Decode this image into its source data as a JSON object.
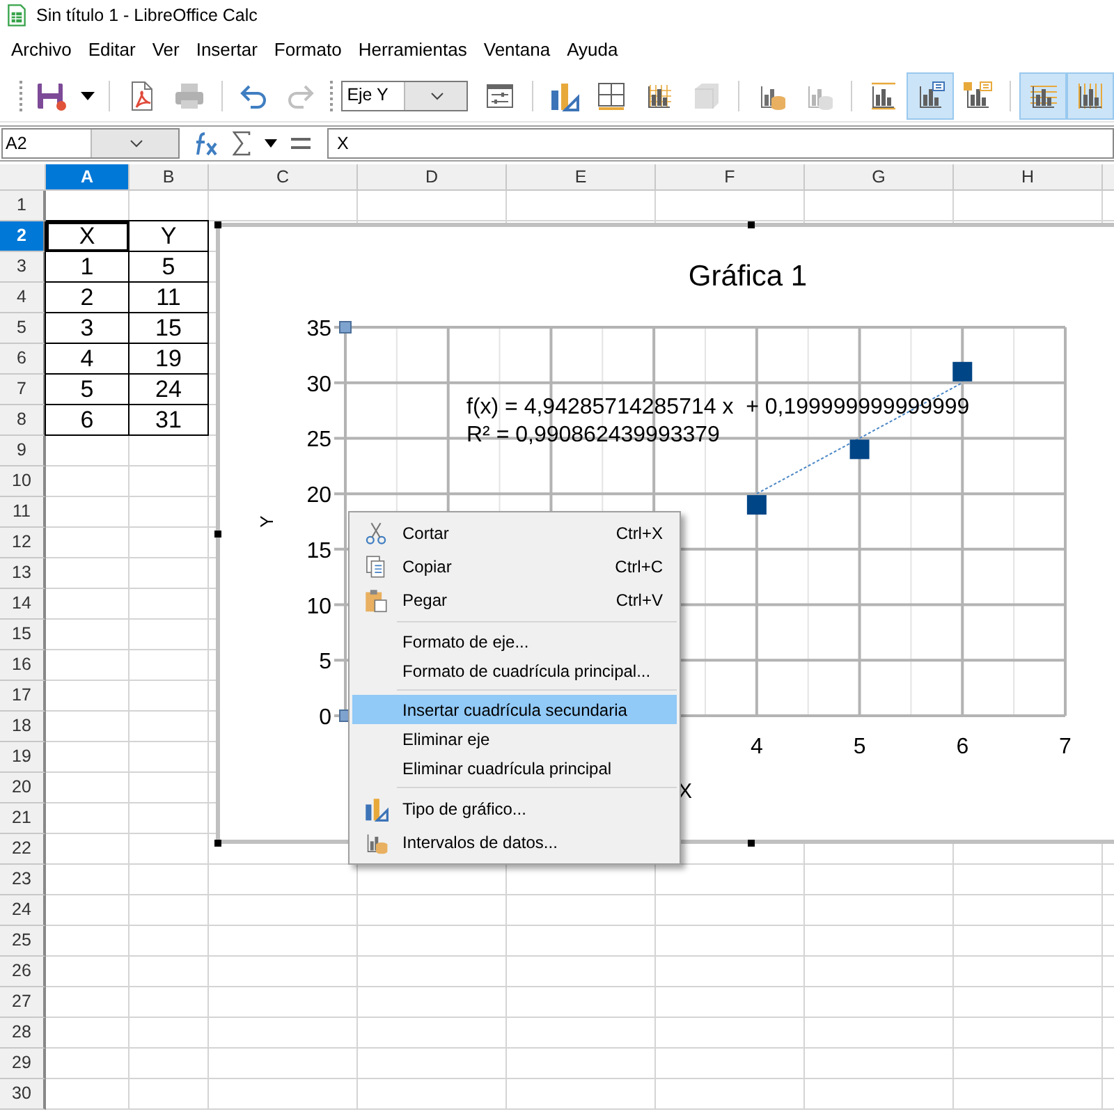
{
  "window": {
    "title": "Sin título 1 - LibreOffice Calc"
  },
  "menu_bar": [
    "Archivo",
    "Editar",
    "Ver",
    "Insertar",
    "Formato",
    "Herramientas",
    "Ventana",
    "Ayuda"
  ],
  "toolbar": {
    "groups": [
      [
        {
          "kind": "save",
          "disabled": false,
          "on": false
        },
        {
          "kind": "dropdown",
          "disabled": false,
          "on": false
        }
      ],
      [
        {
          "kind": "export-pdf",
          "disabled": false,
          "on": false
        },
        {
          "kind": "print",
          "disabled": true,
          "on": false
        }
      ],
      [
        {
          "kind": "undo",
          "disabled": false,
          "on": false
        },
        {
          "kind": "redo",
          "disabled": true,
          "on": false
        }
      ]
    ],
    "object_select": "Eje Y",
    "chart_groups": [
      [
        {
          "kind": "format-selection",
          "disabled": false,
          "on": false
        }
      ],
      [
        {
          "kind": "chart-type",
          "disabled": false,
          "on": false
        },
        {
          "kind": "grid",
          "disabled": false,
          "on": false
        },
        {
          "kind": "chart-wall",
          "disabled": false,
          "on": false
        },
        {
          "kind": "view3d",
          "disabled": true,
          "on": false
        }
      ],
      [
        {
          "kind": "data-ranges",
          "disabled": false,
          "on": false
        },
        {
          "kind": "data-table",
          "disabled": true,
          "on": false
        }
      ],
      [
        {
          "kind": "titles",
          "disabled": false,
          "on": false
        },
        {
          "kind": "legend-toggle",
          "disabled": false,
          "on": true
        },
        {
          "kind": "legend",
          "disabled": false,
          "on": false
        }
      ],
      [
        {
          "kind": "horizontal-grids",
          "disabled": false,
          "on": true
        },
        {
          "kind": "vertical-grids",
          "disabled": false,
          "on": true
        }
      ]
    ]
  },
  "formula_bar": {
    "name_box": "A2",
    "formula": "X"
  },
  "sheet": {
    "columns": [
      {
        "label": "A",
        "selected": true
      },
      {
        "label": "B",
        "selected": false
      },
      {
        "label": "C",
        "selected": false
      },
      {
        "label": "D",
        "selected": false
      },
      {
        "label": "E",
        "selected": false
      },
      {
        "label": "F",
        "selected": false
      },
      {
        "label": "G",
        "selected": false
      },
      {
        "label": "H",
        "selected": false
      }
    ],
    "rows": [
      {
        "label": "1",
        "selected": false
      },
      {
        "label": "2",
        "selected": true
      },
      {
        "label": "3",
        "selected": false
      },
      {
        "label": "4",
        "selected": false
      },
      {
        "label": "5",
        "selected": false
      },
      {
        "label": "6",
        "selected": false
      },
      {
        "label": "7",
        "selected": false
      },
      {
        "label": "8",
        "selected": false
      },
      {
        "label": "9",
        "selected": false
      },
      {
        "label": "10",
        "selected": false
      },
      {
        "label": "11",
        "selected": false
      },
      {
        "label": "12",
        "selected": false
      },
      {
        "label": "13",
        "selected": false
      },
      {
        "label": "14",
        "selected": false
      },
      {
        "label": "15",
        "selected": false
      },
      {
        "label": "16",
        "selected": false
      },
      {
        "label": "17",
        "selected": false
      },
      {
        "label": "18",
        "selected": false
      },
      {
        "label": "19",
        "selected": false
      },
      {
        "label": "20",
        "selected": false
      },
      {
        "label": "21",
        "selected": false
      },
      {
        "label": "22",
        "selected": false
      },
      {
        "label": "23",
        "selected": false
      },
      {
        "label": "24",
        "selected": false
      },
      {
        "label": "25",
        "selected": false
      },
      {
        "label": "26",
        "selected": false
      },
      {
        "label": "27",
        "selected": false
      },
      {
        "label": "28",
        "selected": false
      },
      {
        "label": "29",
        "selected": false
      },
      {
        "label": "30",
        "selected": false
      }
    ],
    "data": [
      [
        {
          "text": "X",
          "cursor": true
        },
        {
          "text": "Y",
          "cursor": false
        }
      ],
      [
        {
          "text": "1",
          "cursor": false
        },
        {
          "text": "5",
          "cursor": false
        }
      ],
      [
        {
          "text": "2",
          "cursor": false
        },
        {
          "text": "11",
          "cursor": false
        }
      ],
      [
        {
          "text": "3",
          "cursor": false
        },
        {
          "text": "15",
          "cursor": false
        }
      ],
      [
        {
          "text": "4",
          "cursor": false
        },
        {
          "text": "19",
          "cursor": false
        }
      ],
      [
        {
          "text": "5",
          "cursor": false
        },
        {
          "text": "24",
          "cursor": false
        }
      ],
      [
        {
          "text": "6",
          "cursor": false
        },
        {
          "text": "31",
          "cursor": false
        }
      ]
    ]
  },
  "chart": {
    "chart_data": {
      "type": "scatter",
      "title": "Gráfica 1",
      "xlabel": "X",
      "ylabel": "Y",
      "x": [
        4,
        5,
        6
      ],
      "series": [
        {
          "color": "#004586",
          "values": [
            19,
            24,
            31
          ]
        },
        {
          "type": "line",
          "line_style": "dotted",
          "color": "#4a86c5",
          "values": [
            20,
            25,
            30
          ]
        }
      ],
      "grid": true,
      "xlim": [
        0,
        7
      ],
      "ylim": [
        0,
        35
      ],
      "xticks": [
        4,
        5,
        6,
        7
      ],
      "yticks": [
        0,
        5,
        10,
        15,
        20,
        25,
        30,
        35
      ],
      "annotations": [
        "f(x) = 4,94285714285714 x  + 0,199999999999999",
        "R² = 0,990862439993379"
      ]
    }
  },
  "context_menu": {
    "groups": [
      [
        {
          "label": "Cortar",
          "shortcut": "Ctrl+X",
          "kind": "cut",
          "selected": false
        },
        {
          "label": "Copiar",
          "shortcut": "Ctrl+C",
          "kind": "copy",
          "selected": false
        },
        {
          "label": "Pegar",
          "shortcut": "Ctrl+V",
          "kind": "paste",
          "selected": false
        }
      ],
      [
        {
          "label": "Formato de eje...",
          "kind": "plain",
          "selected": false
        },
        {
          "label": "Formato de cuadrícula principal...",
          "kind": "plain",
          "selected": false
        }
      ],
      [
        {
          "label": "Insertar cuadrícula secundaria",
          "kind": "plain",
          "selected": true
        },
        {
          "label": "Eliminar eje",
          "kind": "plain",
          "selected": false
        },
        {
          "label": "Eliminar cuadrícula principal",
          "kind": "plain",
          "selected": false
        }
      ],
      [
        {
          "label": "Tipo de gráfico...",
          "kind": "chart-type",
          "selected": false
        },
        {
          "label": "Intervalos de datos...",
          "kind": "data-ranges",
          "selected": false
        }
      ]
    ]
  }
}
